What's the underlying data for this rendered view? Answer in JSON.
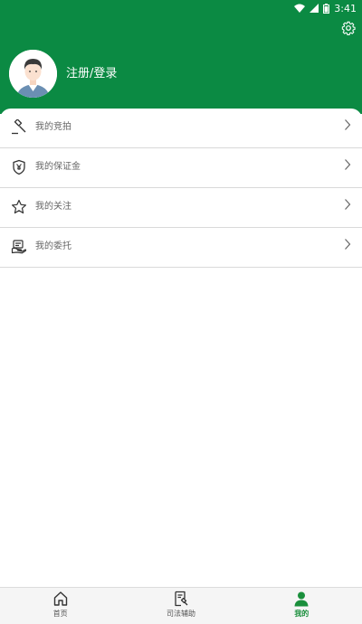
{
  "status": {
    "time": "3:41"
  },
  "header": {
    "login_label": "注册/登录"
  },
  "menu": {
    "items": [
      {
        "label": "我的竞拍",
        "icon": "gavel-icon"
      },
      {
        "label": "我的保证金",
        "icon": "shield-yen-icon"
      },
      {
        "label": "我的关注",
        "icon": "star-icon"
      },
      {
        "label": "我的委托",
        "icon": "delegate-icon"
      }
    ]
  },
  "tabs": [
    {
      "label": "首页",
      "icon": "home-icon",
      "active": false
    },
    {
      "label": "司法辅助",
      "icon": "document-gavel-icon",
      "active": false
    },
    {
      "label": "我的",
      "icon": "person-icon",
      "active": true
    }
  ],
  "colors": {
    "brand": "#0b8a43",
    "active_tab": "#1a8f3c"
  }
}
